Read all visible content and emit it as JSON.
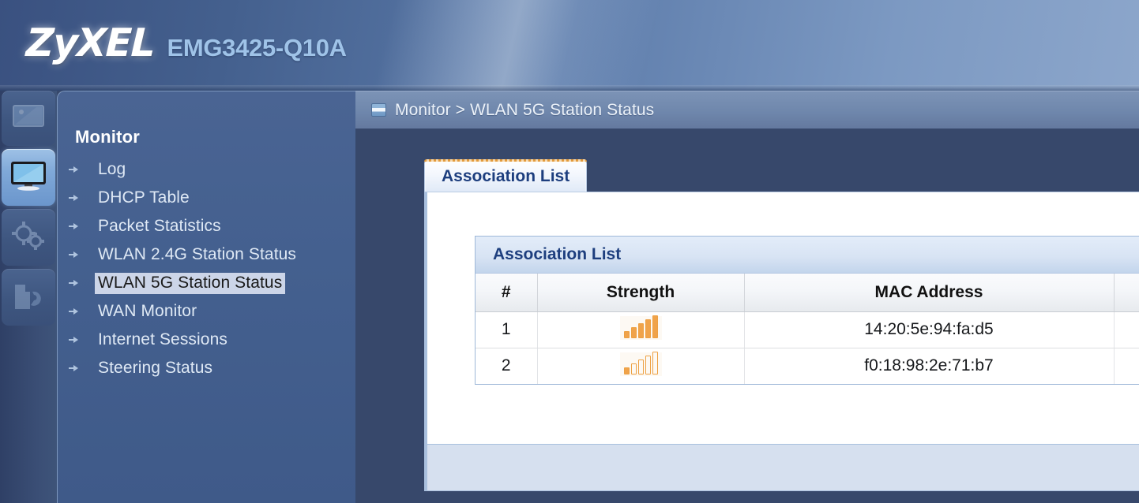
{
  "banner": {
    "brand": "ZyXEL",
    "model": "EMG3425-Q10A"
  },
  "icon_rail": {
    "items": [
      {
        "name": "dashboard-icon",
        "label": "Status",
        "active": false
      },
      {
        "name": "monitor-icon",
        "label": "Monitor",
        "active": true
      },
      {
        "name": "gears-icon",
        "label": "Network",
        "active": false
      },
      {
        "name": "maintenance-icon",
        "label": "Maintenance",
        "active": false
      }
    ]
  },
  "sidebar": {
    "title": "Monitor",
    "items": [
      {
        "label": "Log",
        "selected": false
      },
      {
        "label": "DHCP Table",
        "selected": false
      },
      {
        "label": "Packet Statistics",
        "selected": false
      },
      {
        "label": "WLAN 2.4G Station Status",
        "selected": false
      },
      {
        "label": "WLAN 5G Station Status",
        "selected": true
      },
      {
        "label": "WAN Monitor",
        "selected": false
      },
      {
        "label": "Internet Sessions",
        "selected": false
      },
      {
        "label": "Steering Status",
        "selected": false
      }
    ]
  },
  "breadcrumb": {
    "icon": "page-icon",
    "text": "Monitor > WLAN 5G Station Status"
  },
  "tabs": [
    {
      "label": "Association List",
      "active": true
    }
  ],
  "panel": {
    "title": "Association List",
    "table": {
      "columns": [
        "#",
        "Strength",
        "MAC Address",
        ""
      ],
      "rows": [
        {
          "index": "1",
          "strength_filled": 5,
          "strength_total": 5,
          "mac": "14:20:5e:94:fa:d5",
          "extra": ""
        },
        {
          "index": "2",
          "strength_filled": 1,
          "strength_total": 5,
          "mac": "f0:18:98:2e:71:b7",
          "extra": ""
        }
      ]
    }
  },
  "colors": {
    "banner_dark": "#3a5180",
    "banner_light": "#8ca6cb",
    "stage_navy": "#37486b",
    "sidebar_blue": "#44608f",
    "selection_bg": "#ccd5e8",
    "accent_navy": "#1d3e7e",
    "signal_orange": "#f0a34a",
    "footer_blue": "#d6e0ef"
  }
}
